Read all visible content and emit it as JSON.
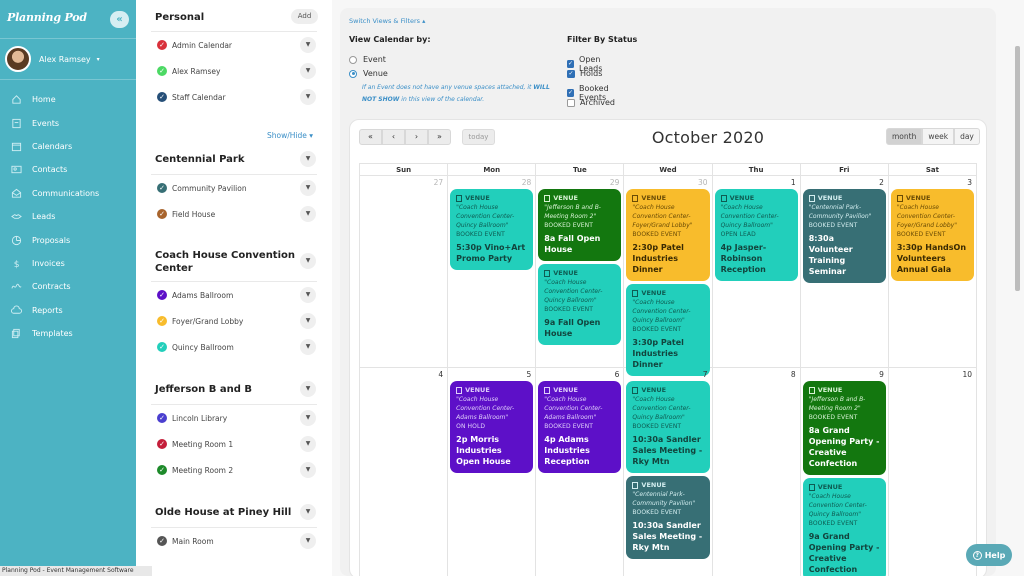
{
  "app": {
    "logo": "Planning Pod",
    "status_bar": "Planning Pod - Event Management Software"
  },
  "nav": {
    "collapse_icon": "«",
    "user": {
      "name": "Alex Ramsey",
      "caret": "▾"
    },
    "items": [
      {
        "label": "Home",
        "icon": "home-icon"
      },
      {
        "label": "Events",
        "icon": "events-icon"
      },
      {
        "label": "Calendars",
        "icon": "calendar-icon"
      },
      {
        "label": "Contacts",
        "icon": "contacts-icon"
      },
      {
        "label": "Communications",
        "icon": "envelope-icon"
      },
      {
        "label": "Leads",
        "icon": "handshake-icon"
      },
      {
        "label": "Proposals",
        "icon": "pie-icon"
      },
      {
        "label": "Invoices",
        "icon": "dollar-icon"
      },
      {
        "label": "Contracts",
        "icon": "signature-icon"
      },
      {
        "label": "Reports",
        "icon": "cloud-icon"
      },
      {
        "label": "Templates",
        "icon": "copy-icon"
      }
    ]
  },
  "calendars": {
    "personal": {
      "title": "Personal",
      "add_label": "Add",
      "items": [
        {
          "name": "Admin Calendar",
          "color": "#d9313b"
        },
        {
          "name": "Alex Ramsey",
          "color": "#4cd964"
        },
        {
          "name": "Staff Calendar",
          "color": "#264f78"
        }
      ]
    },
    "show_hide": "Show/Hide ▾",
    "venues": [
      {
        "title": "Centennial Park",
        "items": [
          {
            "name": "Community Pavilion",
            "color": "#376f75"
          },
          {
            "name": "Field House",
            "color": "#a8642d"
          }
        ]
      },
      {
        "title": "Coach House Convention Center",
        "items": [
          {
            "name": "Adams Ballroom",
            "color": "#5d10c8"
          },
          {
            "name": "Foyer/Grand Lobby",
            "color": "#f8bc2c"
          },
          {
            "name": "Quincy Ballroom",
            "color": "#22cfbb"
          }
        ]
      },
      {
        "title": "Jefferson B and B",
        "items": [
          {
            "name": "Lincoln Library",
            "color": "#4a3fcf"
          },
          {
            "name": "Meeting Room 1",
            "color": "#c41e3a"
          },
          {
            "name": "Meeting Room 2",
            "color": "#1d8a2a"
          }
        ]
      },
      {
        "title": "Olde House at Piney Hill",
        "items": [
          {
            "name": "Main Room",
            "color": "#555555"
          }
        ]
      }
    ]
  },
  "filters": {
    "switch_views": "Switch Views & Filters ▴",
    "view_by_title": "View Calendar by:",
    "view_options": [
      {
        "label": "Event",
        "selected": false
      },
      {
        "label": "Venue",
        "selected": true
      }
    ],
    "venue_note_pre": "If an Event does not have any venue spaces attached, it ",
    "venue_note_bold1": "WILL",
    "venue_note_bold2": "NOT SHOW",
    "venue_note_post": " in this view of the calendar.",
    "status_title": "Filter By Status",
    "status_options": [
      {
        "label": "Open Leads",
        "checked": true
      },
      {
        "label": "Holds",
        "checked": true
      },
      {
        "label": "Booked Events",
        "checked": true
      },
      {
        "label": "Archived",
        "checked": false
      }
    ]
  },
  "calendar": {
    "title": "October 2020",
    "nav_buttons": [
      "«",
      "‹",
      "›",
      "»"
    ],
    "today_label": "today",
    "views": [
      {
        "label": "month",
        "active": true
      },
      {
        "label": "week",
        "active": false
      },
      {
        "label": "day",
        "active": false
      }
    ],
    "days_of_week": [
      "Sun",
      "Mon",
      "Tue",
      "Wed",
      "Thu",
      "Fri",
      "Sat"
    ],
    "weeks": [
      {
        "days": [
          {
            "num": "27",
            "other": true,
            "events": []
          },
          {
            "num": "28",
            "other": true,
            "events": [
              {
                "kind": "VENUE",
                "venue": "\"Coach House Convention Center-Quincy Ballroom\"",
                "status": "BOOKED EVENT",
                "title": "5:30p Vino+Art Promo Party",
                "style": "teal"
              }
            ]
          },
          {
            "num": "29",
            "other": true,
            "events": [
              {
                "kind": "VENUE",
                "venue": "\"Jefferson B and B-Meeting Room 2\"",
                "status": "BOOKED EVENT",
                "title": "8a Fall Open House",
                "style": "green"
              },
              {
                "kind": "VENUE",
                "venue": "\"Coach House Convention Center-Quincy Ballroom\"",
                "status": "BOOKED EVENT",
                "title": "9a Fall Open House",
                "style": "teal"
              }
            ]
          },
          {
            "num": "30",
            "other": true,
            "events": [
              {
                "kind": "VENUE",
                "venue": "\"Coach House Convention Center-Foyer/Grand Lobby\"",
                "status": "BOOKED EVENT",
                "title": "2:30p Patel Industries Dinner",
                "style": "orange"
              },
              {
                "kind": "VENUE",
                "venue": "\"Coach House Convention Center-Quincy Ballroom\"",
                "status": "BOOKED EVENT",
                "title": "3:30p Patel Industries Dinner",
                "style": "teal"
              }
            ]
          },
          {
            "num": "1",
            "other": false,
            "events": [
              {
                "kind": "VENUE",
                "venue": "\"Coach House Convention Center-Quincy Ballroom\"",
                "status": "OPEN LEAD",
                "title": "4p Jasper-Robinson Reception",
                "style": "teal"
              }
            ]
          },
          {
            "num": "2",
            "other": false,
            "events": [
              {
                "kind": "VENUE",
                "venue": "\"Centennial Park-Community Pavilion\"",
                "status": "BOOKED EVENT",
                "title": "8:30a Volunteer Training Seminar",
                "style": "slate"
              }
            ]
          },
          {
            "num": "3",
            "other": false,
            "events": [
              {
                "kind": "VENUE",
                "venue": "\"Coach House Convention Center-Foyer/Grand Lobby\"",
                "status": "BOOKED EVENT",
                "title": "3:30p HandsOn Volunteers Annual Gala",
                "style": "orange"
              }
            ]
          }
        ]
      },
      {
        "days": [
          {
            "num": "4",
            "other": false,
            "events": []
          },
          {
            "num": "5",
            "other": false,
            "events": [
              {
                "kind": "VENUE",
                "venue": "\"Coach House Convention Center-Adams Ballroom\"",
                "status": "ON HOLD",
                "title": "2p Morris Industries Open House",
                "style": "purple"
              }
            ]
          },
          {
            "num": "6",
            "other": false,
            "events": [
              {
                "kind": "VENUE",
                "venue": "\"Coach House Convention Center-Adams Ballroom\"",
                "status": "BOOKED EVENT",
                "title": "4p Adams Industries Reception",
                "style": "purple"
              }
            ]
          },
          {
            "num": "7",
            "other": false,
            "events": [
              {
                "kind": "VENUE",
                "venue": "\"Coach House Convention Center-Quincy Ballroom\"",
                "status": "BOOKED EVENT",
                "title": "10:30a Sandler Sales Meeting - Rky Mtn",
                "style": "teal"
              },
              {
                "kind": "VENUE",
                "venue": "\"Centennial Park-Community Pavilion\"",
                "status": "BOOKED EVENT",
                "title": "10:30a Sandler Sales Meeting - Rky Mtn",
                "style": "slate"
              }
            ]
          },
          {
            "num": "8",
            "other": false,
            "events": []
          },
          {
            "num": "9",
            "other": false,
            "events": [
              {
                "kind": "VENUE",
                "venue": "\"Jefferson B and B-Meeting Room 2\"",
                "status": "BOOKED EVENT",
                "title": "8a Grand Opening Party - Creative Confection",
                "style": "green"
              },
              {
                "kind": "VENUE",
                "venue": "\"Coach House Convention Center-Quincy Ballroom\"",
                "status": "BOOKED EVENT",
                "title": "9a Grand Opening Party - Creative Confection",
                "style": "teal"
              }
            ]
          },
          {
            "num": "10",
            "other": false,
            "events": []
          }
        ]
      }
    ]
  },
  "help": {
    "label": "Help",
    "icon": "?"
  }
}
